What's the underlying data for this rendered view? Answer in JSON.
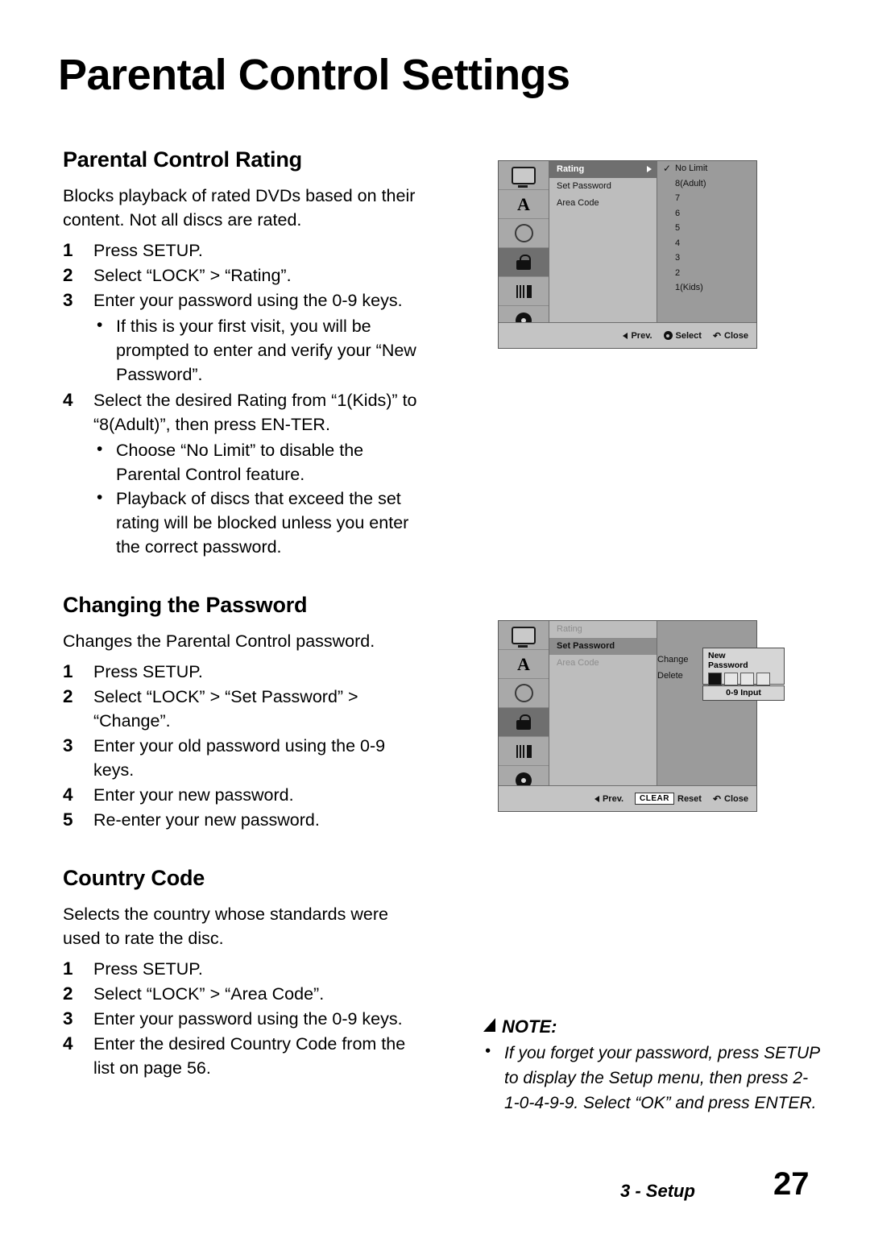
{
  "document": {
    "title": "Parental Control Settings",
    "footer_section": "3 - Setup",
    "page_number": "27"
  },
  "sections": [
    {
      "heading": "Parental Control Rating",
      "intro": "Blocks playback of rated DVDs based on their content. Not all discs are rated.",
      "steps": [
        {
          "num": "1",
          "text": "Press SETUP."
        },
        {
          "num": "2",
          "text": "Select “LOCK” > “Rating”."
        },
        {
          "num": "3",
          "text": "Enter your password using the 0-9 keys."
        },
        {
          "num": "4",
          "text": "Select the desired Rating from “1(Kids)” to “8(Adult)”, then press EN-TER."
        }
      ],
      "bullets_after_3": [
        "If this is your first visit, you will be prompted to enter and verify your “New Password”."
      ],
      "bullets_after_4": [
        "Choose “No Limit” to disable the Parental Control feature.",
        "Playback of discs that exceed the set rating will be blocked unless you enter the correct password."
      ]
    },
    {
      "heading": "Changing the Password",
      "intro": "Changes the Parental Control password.",
      "steps": [
        {
          "num": "1",
          "text": "Press SETUP."
        },
        {
          "num": "2",
          "text": "Select “LOCK” > “Set Password” > “Change”."
        },
        {
          "num": "3",
          "text": "Enter your old password using the 0-9 keys."
        },
        {
          "num": "4",
          "text": "Enter your new password."
        },
        {
          "num": "5",
          "text": "Re-enter your new password."
        }
      ]
    },
    {
      "heading": "Country Code",
      "intro": "Selects the country whose standards were used to rate the disc.",
      "steps": [
        {
          "num": "1",
          "text": "Press SETUP."
        },
        {
          "num": "2",
          "text": "Select “LOCK” > “Area Code”."
        },
        {
          "num": "3",
          "text": "Enter your password using the 0-9 keys."
        },
        {
          "num": "4",
          "text": "Enter the desired Country Code from the list on page 56."
        }
      ]
    }
  ],
  "osd_rating": {
    "rail_icons": [
      "tv-icon",
      "audio-a-icon",
      "circle-icon",
      "lock-icon",
      "bars-playback-icon",
      "disc-icon"
    ],
    "menu": [
      {
        "label": "Rating",
        "state": "highlight",
        "arrow": true
      },
      {
        "label": "Set Password",
        "state": "normal",
        "arrow": false
      },
      {
        "label": "Area Code",
        "state": "normal",
        "arrow": false
      }
    ],
    "options": [
      {
        "label": "No Limit",
        "checked": true
      },
      {
        "label": "8(Adult)",
        "checked": false
      },
      {
        "label": "7",
        "checked": false
      },
      {
        "label": "6",
        "checked": false
      },
      {
        "label": "5",
        "checked": false
      },
      {
        "label": "4",
        "checked": false
      },
      {
        "label": "3",
        "checked": false
      },
      {
        "label": "2",
        "checked": false
      },
      {
        "label": "1(Kids)",
        "checked": false
      }
    ],
    "footer": {
      "prev": "Prev.",
      "select": "Select",
      "close": "Close"
    }
  },
  "osd_password": {
    "rail_icons": [
      "tv-icon",
      "audio-a-icon",
      "circle-icon",
      "lock-icon",
      "bars-playback-icon",
      "disc-icon"
    ],
    "menu": [
      {
        "label": "Rating",
        "state": "dim",
        "arrow": false
      },
      {
        "label": "Set Password",
        "state": "highlight2",
        "arrow": false
      },
      {
        "label": "Area Code",
        "state": "dim",
        "arrow": false
      }
    ],
    "submenu": [
      "Change",
      "Delete"
    ],
    "popup": {
      "title_line1": "New",
      "title_line2": "Password",
      "boxes": [
        true,
        false,
        false,
        false
      ]
    },
    "input_hint": "0-9 Input",
    "footer": {
      "prev": "Prev.",
      "clear": "CLEAR",
      "reset": "Reset",
      "close": "Close"
    }
  },
  "note": {
    "label": "NOTE:",
    "text": "If you forget your password, press SETUP to display the Setup menu, then press 2-1-0-4-9-9. Select “OK” and press ENTER."
  }
}
